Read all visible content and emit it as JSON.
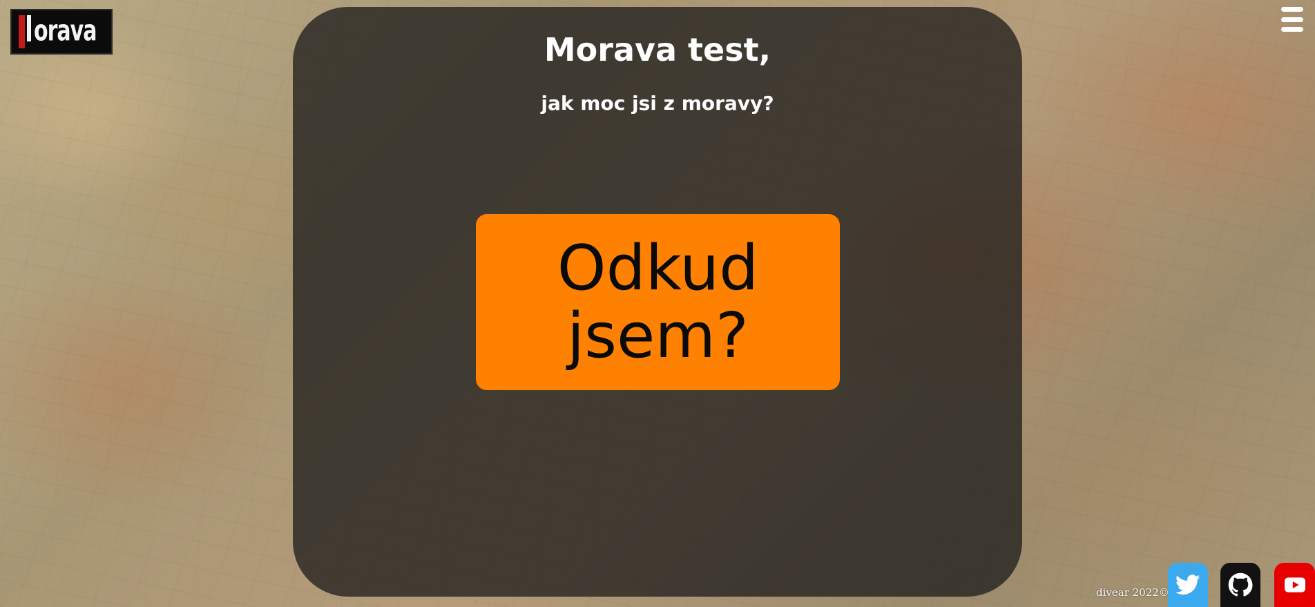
{
  "header": {
    "logo_text": "orava",
    "menu_icon": "hamburger-menu-icon"
  },
  "main": {
    "title": "Morava test,",
    "subtitle": "jak moc jsi z moravy?",
    "start_button_label": "Odkud jsem?"
  },
  "footer": {
    "copyright": "divear 2022©",
    "social": [
      {
        "name": "twitter",
        "icon": "twitter-icon",
        "color": "#3ba9ee"
      },
      {
        "name": "github",
        "icon": "github-icon",
        "color": "#121212"
      },
      {
        "name": "youtube",
        "icon": "youtube-icon",
        "color": "#e60000"
      }
    ]
  },
  "colors": {
    "accent": "#ff8102",
    "logo_red": "#c41c1c",
    "panel": "#191919"
  }
}
